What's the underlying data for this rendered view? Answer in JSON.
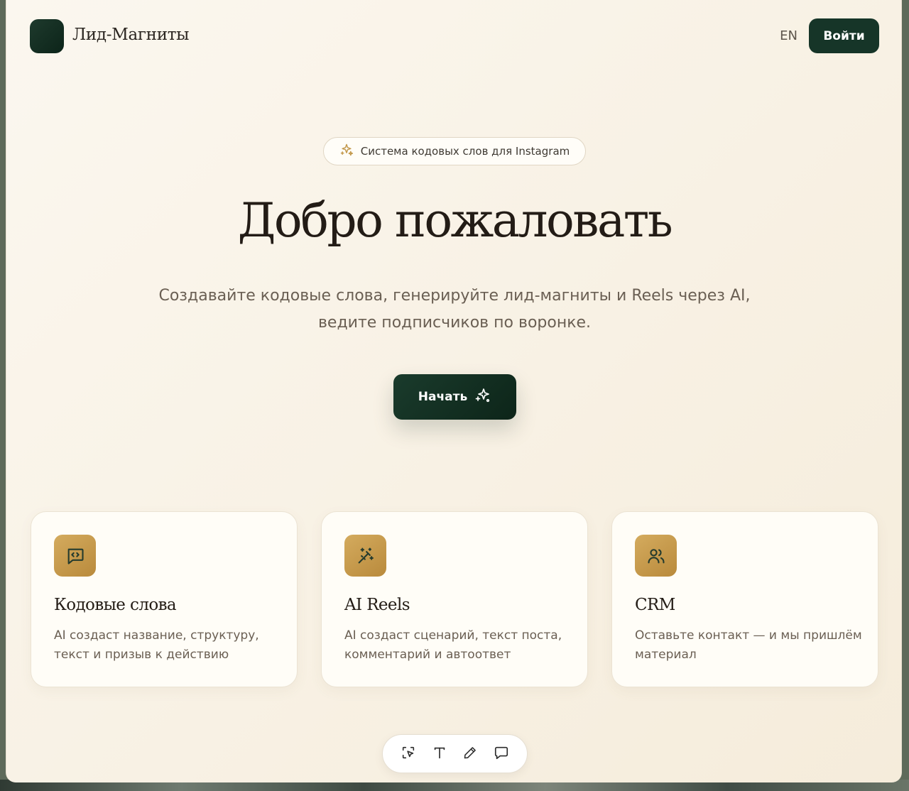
{
  "header": {
    "logo_text": "Лид-Магниты",
    "lang_label": "EN",
    "login_label": "Войти"
  },
  "hero": {
    "badge_text": "Система кодовых слов для Instagram",
    "title": "Добро пожаловать",
    "subtitle": "Создавайте кодовые слова, генерируйте лид-магниты и Reels через AI, ведите подписчиков по воронке.",
    "cta_label": "Начать"
  },
  "features": [
    {
      "icon": "message-code-icon",
      "title": "Кодовые слова",
      "description": "AI создаст название, структуру, текст и призыв к действию"
    },
    {
      "icon": "magic-wand-icon",
      "title": "AI Reels",
      "description": "AI создаст сценарий, текст поста, комментарий и автоответ"
    },
    {
      "icon": "users-icon",
      "title": "CRM",
      "description": "Оставьте контакт — и мы пришлём материал"
    }
  ],
  "toolbar": {
    "tools": [
      "select-icon",
      "text-icon",
      "pencil-icon",
      "comment-icon"
    ]
  },
  "colors": {
    "brand_green": "#163528",
    "accent_gold": "#c99b4c",
    "background": "#faf4e9"
  }
}
